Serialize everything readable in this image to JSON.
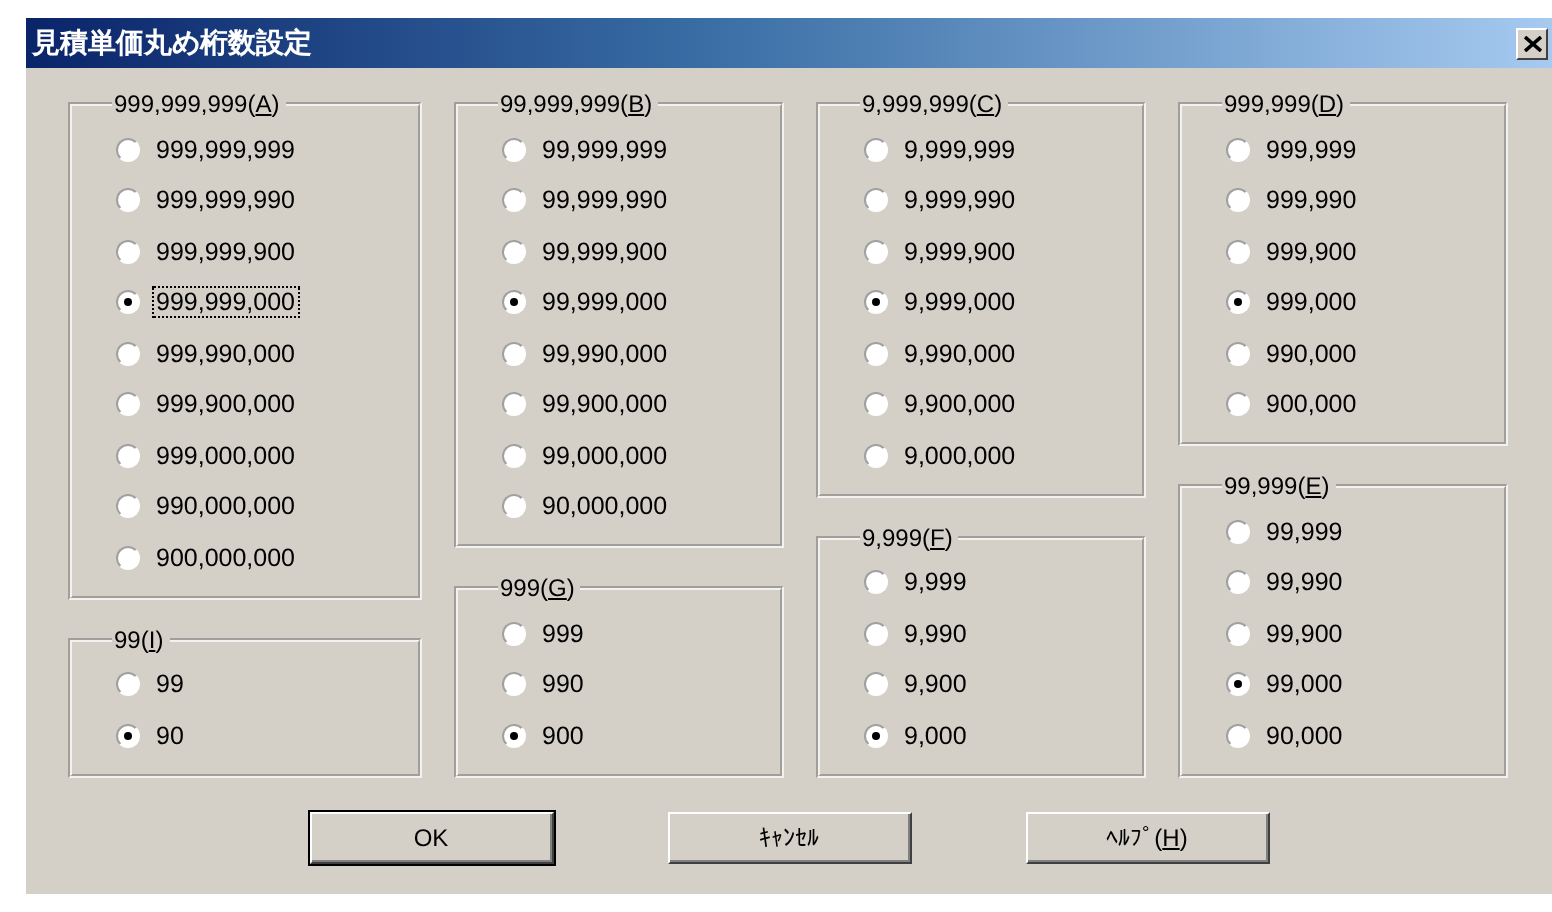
{
  "window": {
    "title": "見積単価丸め桁数設定"
  },
  "columns": [
    {
      "groups": [
        {
          "label": [
            "999,999,999(",
            "A",
            ")"
          ],
          "options": [
            {
              "text": "999,999,999",
              "selected": false,
              "focused": false
            },
            {
              "text": "999,999,990",
              "selected": false,
              "focused": false
            },
            {
              "text": "999,999,900",
              "selected": false,
              "focused": false
            },
            {
              "text": "999,999,000",
              "selected": true,
              "focused": true
            },
            {
              "text": "999,990,000",
              "selected": false,
              "focused": false
            },
            {
              "text": "999,900,000",
              "selected": false,
              "focused": false
            },
            {
              "text": "999,000,000",
              "selected": false,
              "focused": false
            },
            {
              "text": "990,000,000",
              "selected": false,
              "focused": false
            },
            {
              "text": "900,000,000",
              "selected": false,
              "focused": false
            }
          ]
        },
        {
          "label": [
            "99(",
            "I",
            ")"
          ],
          "options": [
            {
              "text": "99",
              "selected": false,
              "focused": false
            },
            {
              "text": "90",
              "selected": true,
              "focused": false
            }
          ]
        }
      ]
    },
    {
      "groups": [
        {
          "label": [
            "99,999,999(",
            "B",
            ")"
          ],
          "options": [
            {
              "text": "99,999,999",
              "selected": false,
              "focused": false
            },
            {
              "text": "99,999,990",
              "selected": false,
              "focused": false
            },
            {
              "text": "99,999,900",
              "selected": false,
              "focused": false
            },
            {
              "text": "99,999,000",
              "selected": true,
              "focused": false
            },
            {
              "text": "99,990,000",
              "selected": false,
              "focused": false
            },
            {
              "text": "99,900,000",
              "selected": false,
              "focused": false
            },
            {
              "text": "99,000,000",
              "selected": false,
              "focused": false
            },
            {
              "text": "90,000,000",
              "selected": false,
              "focused": false
            }
          ]
        },
        {
          "label": [
            "999(",
            "G",
            ")"
          ],
          "options": [
            {
              "text": "999",
              "selected": false,
              "focused": false
            },
            {
              "text": "990",
              "selected": false,
              "focused": false
            },
            {
              "text": "900",
              "selected": true,
              "focused": false
            }
          ]
        }
      ]
    },
    {
      "groups": [
        {
          "label": [
            "9,999,999(",
            "C",
            ")"
          ],
          "options": [
            {
              "text": "9,999,999",
              "selected": false,
              "focused": false
            },
            {
              "text": "9,999,990",
              "selected": false,
              "focused": false
            },
            {
              "text": "9,999,900",
              "selected": false,
              "focused": false
            },
            {
              "text": "9,999,000",
              "selected": true,
              "focused": false
            },
            {
              "text": "9,990,000",
              "selected": false,
              "focused": false
            },
            {
              "text": "9,900,000",
              "selected": false,
              "focused": false
            },
            {
              "text": "9,000,000",
              "selected": false,
              "focused": false
            }
          ]
        },
        {
          "label": [
            "9,999(",
            "F",
            ")"
          ],
          "options": [
            {
              "text": "9,999",
              "selected": false,
              "focused": false
            },
            {
              "text": "9,990",
              "selected": false,
              "focused": false
            },
            {
              "text": "9,900",
              "selected": false,
              "focused": false
            },
            {
              "text": "9,000",
              "selected": true,
              "focused": false
            }
          ]
        }
      ]
    },
    {
      "groups": [
        {
          "label": [
            "999,999(",
            "D",
            ")"
          ],
          "options": [
            {
              "text": "999,999",
              "selected": false,
              "focused": false
            },
            {
              "text": "999,990",
              "selected": false,
              "focused": false
            },
            {
              "text": "999,900",
              "selected": false,
              "focused": false
            },
            {
              "text": "999,000",
              "selected": true,
              "focused": false
            },
            {
              "text": "990,000",
              "selected": false,
              "focused": false
            },
            {
              "text": "900,000",
              "selected": false,
              "focused": false
            }
          ]
        },
        {
          "label": [
            "99,999(",
            "E",
            ")"
          ],
          "options": [
            {
              "text": "99,999",
              "selected": false,
              "focused": false
            },
            {
              "text": "99,990",
              "selected": false,
              "focused": false
            },
            {
              "text": "99,900",
              "selected": false,
              "focused": false
            },
            {
              "text": "99,000",
              "selected": true,
              "focused": false
            },
            {
              "text": "90,000",
              "selected": false,
              "focused": false
            }
          ]
        }
      ]
    }
  ],
  "buttons": [
    {
      "label": [
        "OK"
      ],
      "default": true
    },
    {
      "label": [
        "ｷｬﾝｾﾙ"
      ],
      "default": false
    },
    {
      "label": [
        "ﾍﾙﾌﾟ(",
        "H",
        ")"
      ],
      "default": false
    }
  ]
}
